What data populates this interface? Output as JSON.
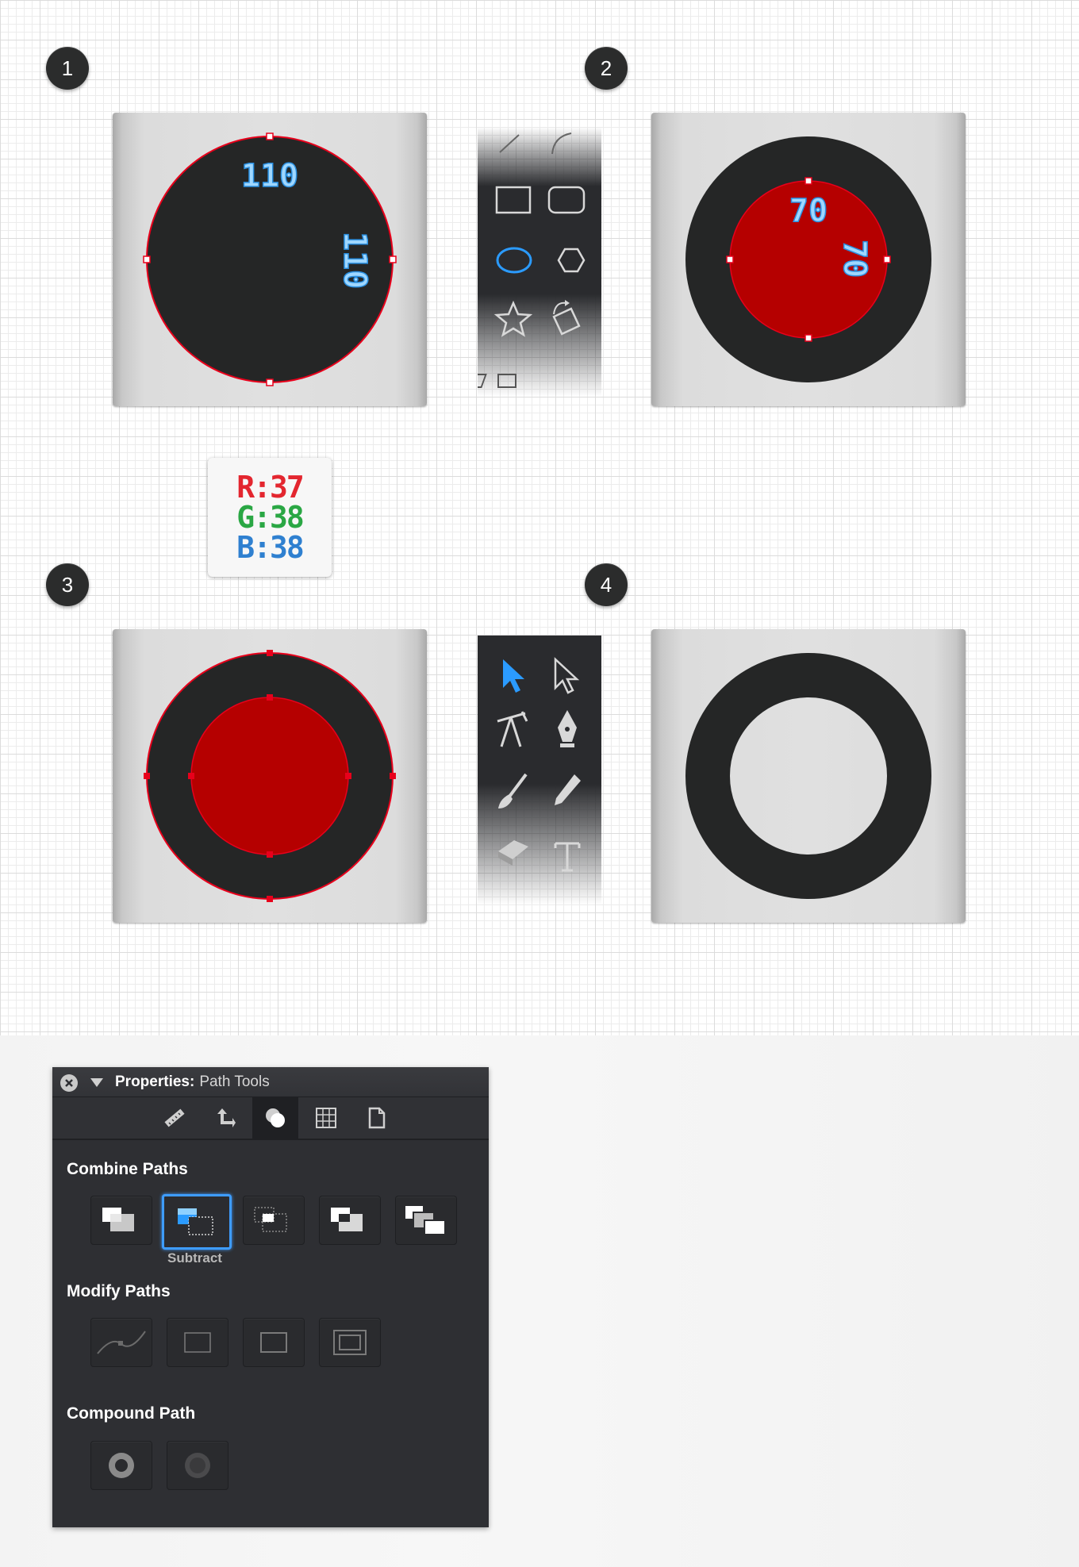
{
  "steps": [
    "1",
    "2",
    "3",
    "4"
  ],
  "step1": {
    "width_label": "110",
    "height_label": "110"
  },
  "step2": {
    "width_label": "70",
    "height_label": "70"
  },
  "rgb": {
    "r": "R:37",
    "g": "G:38",
    "b": "B:38"
  },
  "colors": {
    "dark_fill": "#252626",
    "red_fill": "#b50000",
    "guide_stroke": "#e8001b",
    "dimension_text": "#4fb8ff",
    "active_tool": "#2b9bff",
    "r_color": "#e3262f",
    "g_color": "#2aa744",
    "b_color": "#2f80d0",
    "selected_button": "#3e9cff"
  },
  "shape_tools": [
    "line-tool",
    "arc-tool",
    "rectangle-tool",
    "rounded-rectangle-tool",
    "ellipse-tool",
    "polygon-tool",
    "star-tool",
    "transform-tool"
  ],
  "selection_tools": [
    "select-tool",
    "direct-select-tool",
    "transform-tool",
    "pen-tool",
    "brush-tool",
    "pencil-tool",
    "eraser-tool",
    "type-tool"
  ],
  "panel": {
    "title_bold": "Properties:",
    "title_rest": "Path Tools",
    "tabs": [
      "ruler-icon",
      "move-icon",
      "combine-icon",
      "grid-icon",
      "document-icon"
    ],
    "active_tab": "combine-icon",
    "sections": {
      "combine": "Combine Paths",
      "modify": "Modify Paths",
      "compound": "Compound Path"
    },
    "combine_buttons": [
      "unite",
      "subtract",
      "intersect",
      "exclude",
      "divide"
    ],
    "selected_combine": "Subtract",
    "modify_buttons": [
      "smooth-path",
      "outline-stroke",
      "expand",
      "offset"
    ],
    "compound_buttons": [
      "make-compound",
      "release-compound"
    ]
  }
}
